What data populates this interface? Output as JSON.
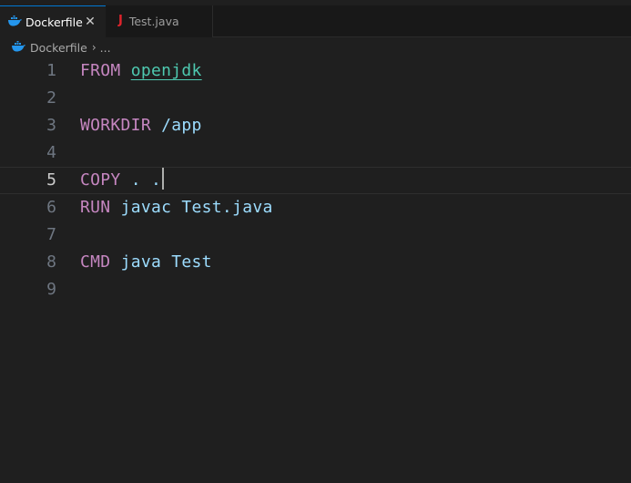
{
  "tabs": [
    {
      "label": "Dockerfile",
      "icon": "docker-whale-icon",
      "active": true
    },
    {
      "label": "Test.java",
      "icon": "java-icon",
      "active": false
    }
  ],
  "breadcrumb": {
    "file": "Dockerfile",
    "rest": "..."
  },
  "editor": {
    "current_line": 5,
    "lines": [
      {
        "number": "1",
        "keyword": "FROM",
        "argument": "openjdk"
      },
      {
        "number": "2",
        "keyword": "",
        "argument": ""
      },
      {
        "number": "3",
        "keyword": "WORKDIR",
        "argument": "/app"
      },
      {
        "number": "4",
        "keyword": "",
        "argument": ""
      },
      {
        "number": "5",
        "keyword": "COPY",
        "argument": ". ."
      },
      {
        "number": "6",
        "keyword": "RUN",
        "argument": "javac Test.java"
      },
      {
        "number": "7",
        "keyword": "",
        "argument": ""
      },
      {
        "number": "8",
        "keyword": "CMD",
        "argument": "java Test"
      },
      {
        "number": "9",
        "keyword": "",
        "argument": ""
      }
    ]
  },
  "colors": {
    "background": "#1f1f1f",
    "keyword": "#c586c0",
    "argument": "#9cdcfe",
    "image_name": "#4ec9b0",
    "active_tab_border": "#0078d4",
    "java_icon": "#e0242c",
    "docker_icon": "#2496ed"
  }
}
